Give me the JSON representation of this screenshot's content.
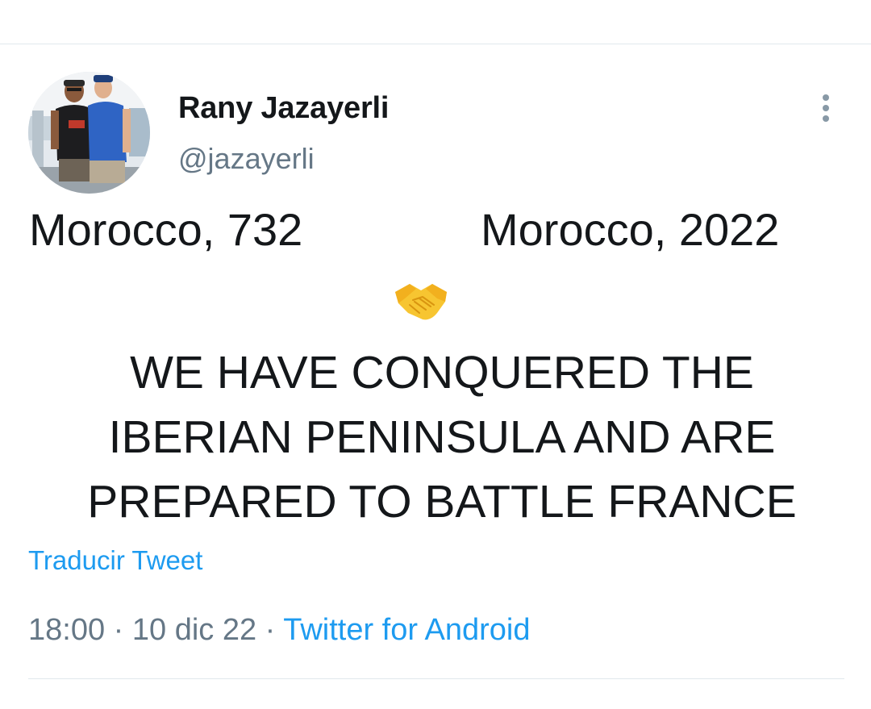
{
  "header": {
    "display_name": "Rany Jazayerli",
    "handle": "@jazayerli",
    "avatar_icon": "profile-photo",
    "more_icon": "more-vertical-icon"
  },
  "tweet": {
    "line_left": "Morocco, 732",
    "line_right": "Morocco, 2022",
    "emoji_icon": "handshake-emoji-icon",
    "caps_lines": [
      "WE HAVE CONQUERED THE",
      "IBERIAN PENINSULA AND ARE",
      "PREPARED TO BATTLE FRANCE"
    ],
    "translate_label": "Traducir Tweet"
  },
  "meta": {
    "time": "18:00",
    "separator": "·",
    "date": "10 dic 22",
    "source": "Twitter for Android"
  },
  "colors": {
    "link": "#1d9bf0",
    "secondary_text": "#657786",
    "primary_text": "#14171a",
    "divider": "#e1e8ed"
  }
}
